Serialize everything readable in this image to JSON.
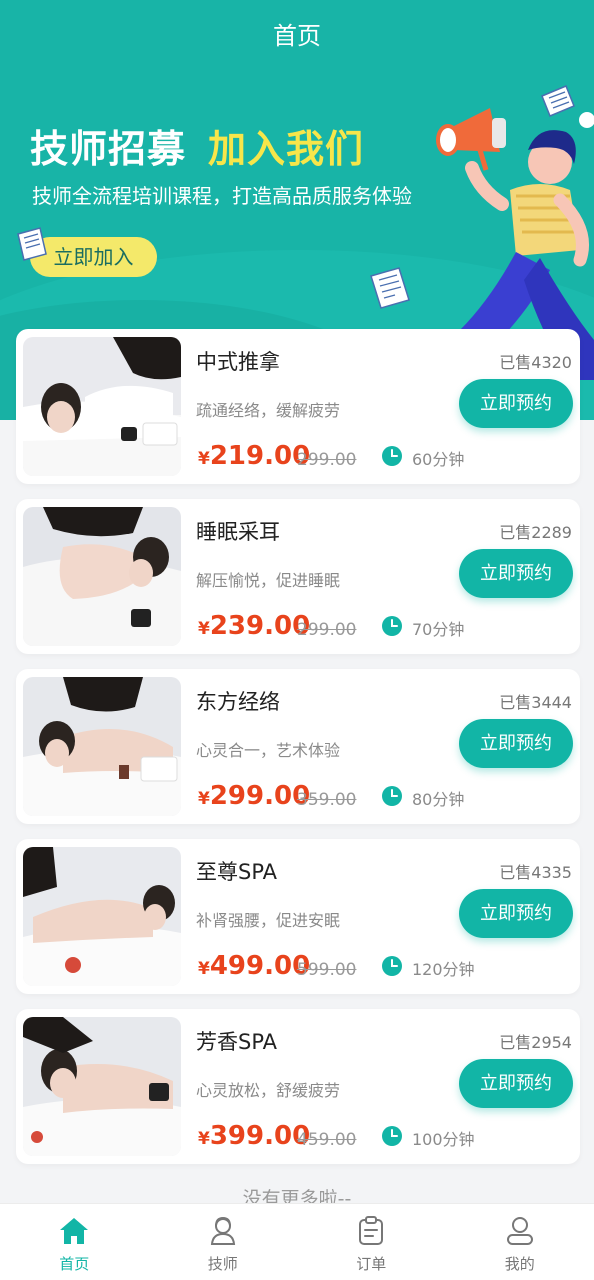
{
  "navbar": {
    "title": "首页"
  },
  "banner": {
    "title_white": "技师招募",
    "title_yellow": "加入我们",
    "subtitle": "技师全流程培训课程，打造高品质服务体验",
    "join_label": "立即加入"
  },
  "colors": {
    "accent": "#18b4a7",
    "price": "#e8431c",
    "banner_yellow": "#f7e64a"
  },
  "services": [
    {
      "name": "中式推拿",
      "sold": "已售4320",
      "desc": "疏通经络，缓解疲劳",
      "currency": "¥",
      "price": "219.00",
      "original": "299.00",
      "duration": "60分钟",
      "button": "立即预约"
    },
    {
      "name": "睡眠采耳",
      "sold": "已售2289",
      "desc": "解压愉悦，促进睡眠",
      "currency": "¥",
      "price": "239.00",
      "original": "299.00",
      "duration": "70分钟",
      "button": "立即预约"
    },
    {
      "name": "东方经络",
      "sold": "已售3444",
      "desc": "心灵合一，艺术体验",
      "currency": "¥",
      "price": "299.00",
      "original": "359.00",
      "duration": "80分钟",
      "button": "立即预约"
    },
    {
      "name": "至尊SPA",
      "sold": "已售4335",
      "desc": "补肾强腰，促进安眠",
      "currency": "¥",
      "price": "499.00",
      "original": "599.00",
      "duration": "120分钟",
      "button": "立即预约"
    },
    {
      "name": "芳香SPA",
      "sold": "已售2954",
      "desc": "心灵放松，舒缓疲劳",
      "currency": "¥",
      "price": "399.00",
      "original": "459.00",
      "duration": "100分钟",
      "button": "立即预约"
    }
  ],
  "footer_note": "没有更多啦--",
  "tabbar": [
    {
      "label": "首页",
      "icon": "home-icon",
      "active": true
    },
    {
      "label": "技师",
      "icon": "technician-icon",
      "active": false
    },
    {
      "label": "订单",
      "icon": "order-icon",
      "active": false
    },
    {
      "label": "我的",
      "icon": "profile-icon",
      "active": false
    }
  ]
}
